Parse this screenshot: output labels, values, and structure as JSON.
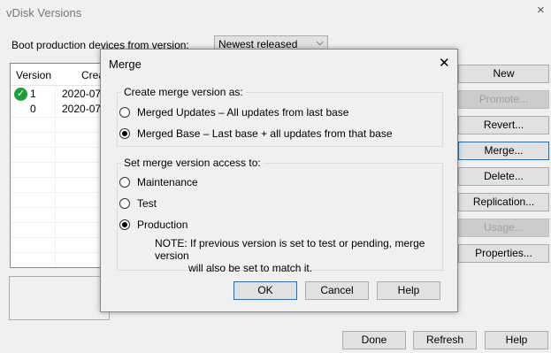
{
  "window": {
    "title": "vDisk Versions",
    "close_glyph": "×"
  },
  "boot": {
    "label": "Boot production devices from version:",
    "selected": "Newest released"
  },
  "list": {
    "headers": [
      "Version",
      "Crea"
    ],
    "rows": [
      {
        "version": "1",
        "created": "2020-07-",
        "status_icon": "check-icon"
      },
      {
        "version": "0",
        "created": "2020-07-"
      }
    ]
  },
  "side_buttons": [
    {
      "label": "New",
      "enabled": true
    },
    {
      "label": "Promote...",
      "enabled": false
    },
    {
      "label": "Revert...",
      "enabled": true
    },
    {
      "label": "Merge...",
      "enabled": true
    },
    {
      "label": "Delete...",
      "enabled": true
    },
    {
      "label": "Replication...",
      "enabled": true
    },
    {
      "label": "Usage...",
      "enabled": false
    },
    {
      "label": "Properties...",
      "enabled": true
    }
  ],
  "bottom_buttons": {
    "done": "Done",
    "refresh": "Refresh",
    "help": "Help"
  },
  "dialog": {
    "title": "Merge",
    "close_glyph": "✕",
    "merge_group": {
      "label": "Create merge version as:",
      "options": [
        {
          "label": "Merged Updates – All updates from last base",
          "selected": false
        },
        {
          "label": "Merged Base – Last base + all updates from that base",
          "selected": true
        }
      ]
    },
    "access_group": {
      "label": "Set merge version access to:",
      "options": [
        {
          "label": "Maintenance",
          "selected": false
        },
        {
          "label": "Test",
          "selected": false
        },
        {
          "label": "Production",
          "selected": true
        }
      ],
      "note_line1": "NOTE:  If previous version is set to test or pending, merge version",
      "note_line2": "will also be set to match it."
    },
    "buttons": {
      "ok": "OK",
      "cancel": "Cancel",
      "help": "Help"
    }
  },
  "colors": {
    "focus": "#0078d7",
    "check": "#1f9d3b"
  }
}
